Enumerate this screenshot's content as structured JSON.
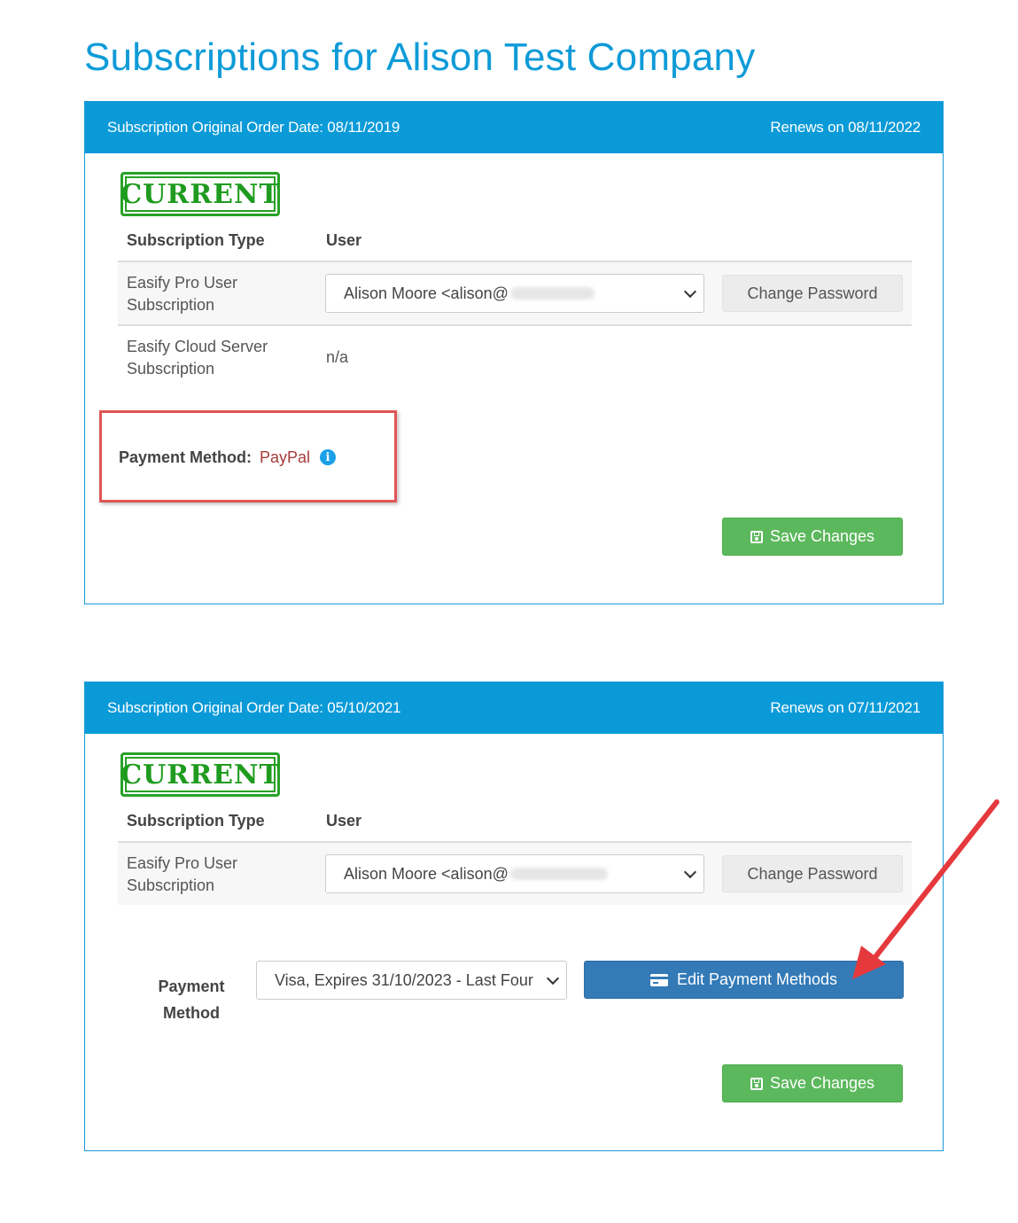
{
  "page": {
    "title": "Subscriptions for Alison Test Company"
  },
  "subscriptions": [
    {
      "order_date_label": "Subscription Original Order Date: 08/11/2019",
      "renews_label": "Renews on 08/11/2022",
      "status_stamp": "CURRENT",
      "columns": {
        "type": "Subscription Type",
        "user": "User"
      },
      "rows": [
        {
          "type": "Easify Pro User Subscription",
          "user_select": "Alison Moore <alison@",
          "change_password": "Change Password"
        },
        {
          "type": "Easify Cloud Server Subscription",
          "user": "n/a"
        }
      ],
      "payment_method_label": "Payment Method:",
      "payment_method_value": "PayPal",
      "save_label": "Save Changes"
    },
    {
      "order_date_label": "Subscription Original Order Date: 05/10/2021",
      "renews_label": "Renews on 07/11/2021",
      "status_stamp": "CURRENT",
      "columns": {
        "type": "Subscription Type",
        "user": "User"
      },
      "rows": [
        {
          "type": "Easify Pro User Subscription",
          "user_select": "Alison Moore <alison@",
          "change_password": "Change Password"
        }
      ],
      "payment_method_label": "Payment Method",
      "payment_method_select": "Visa, Expires 31/10/2023 - Last Four",
      "edit_payment_label": "Edit Payment Methods",
      "save_label": "Save Changes"
    }
  ],
  "annotations": {
    "highlight_color": "#e05555",
    "arrow_color": "#e5393d"
  },
  "colors": {
    "accent": "#0a9ad8",
    "save_green": "#5cb85c",
    "edit_blue": "#337ab7"
  }
}
